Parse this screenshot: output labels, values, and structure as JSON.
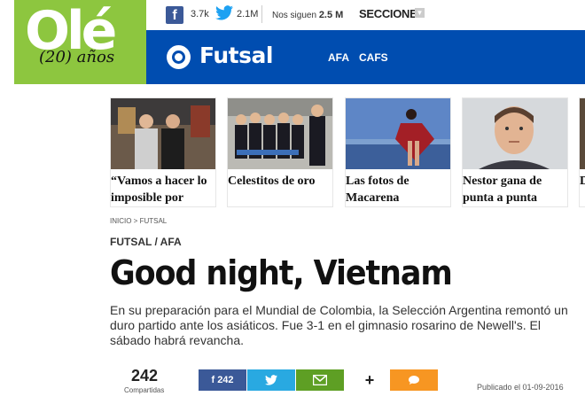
{
  "brand": {
    "logo_text": "Olé",
    "logo_sub": "(20) años"
  },
  "topbar": {
    "facebook_count": "3.7k",
    "twitter_count": "2.1M",
    "follow_label": "Nos siguen",
    "follow_count": "2.5 M",
    "secciones": "SECCIONES"
  },
  "section": {
    "title": "Futsal",
    "nav": [
      "AFA",
      "CAFS"
    ]
  },
  "cards": [
    {
      "title": "“Vamos a hacer lo imposible por",
      "image": "two-players-photo"
    },
    {
      "title": "Celestitos de oro",
      "image": "team-kids-photo"
    },
    {
      "title": "Las fotos de Macarena",
      "image": "woman-lake-photo"
    },
    {
      "title": "Nestor gana de punta a punta",
      "image": "man-portrait-photo"
    },
    {
      "title": "D",
      "image": "partial-card"
    }
  ],
  "breadcrumb": "INICIO > FUTSAL",
  "article": {
    "kicker": "FUTSAL / AFA",
    "headline": "Good night, Vietnam",
    "summary": "En su preparación para el Mundial de Colombia, la Selección Argentina remontó un duro partido ante los asiáticos. Fue 3-1 en el gimnasio rosarino de Newell's. El sábado habrá revancha."
  },
  "share": {
    "count": "242",
    "count_label": "Compartidas",
    "facebook_label": "242",
    "plus_label": "+",
    "published": "Publicado el 01-09-2016"
  },
  "colors": {
    "brand_green": "#8dc63f",
    "section_blue": "#004db0",
    "facebook": "#3b5998",
    "twitter": "#29a9e1",
    "email": "#5e9f24",
    "whatsapp": "#f79622"
  }
}
